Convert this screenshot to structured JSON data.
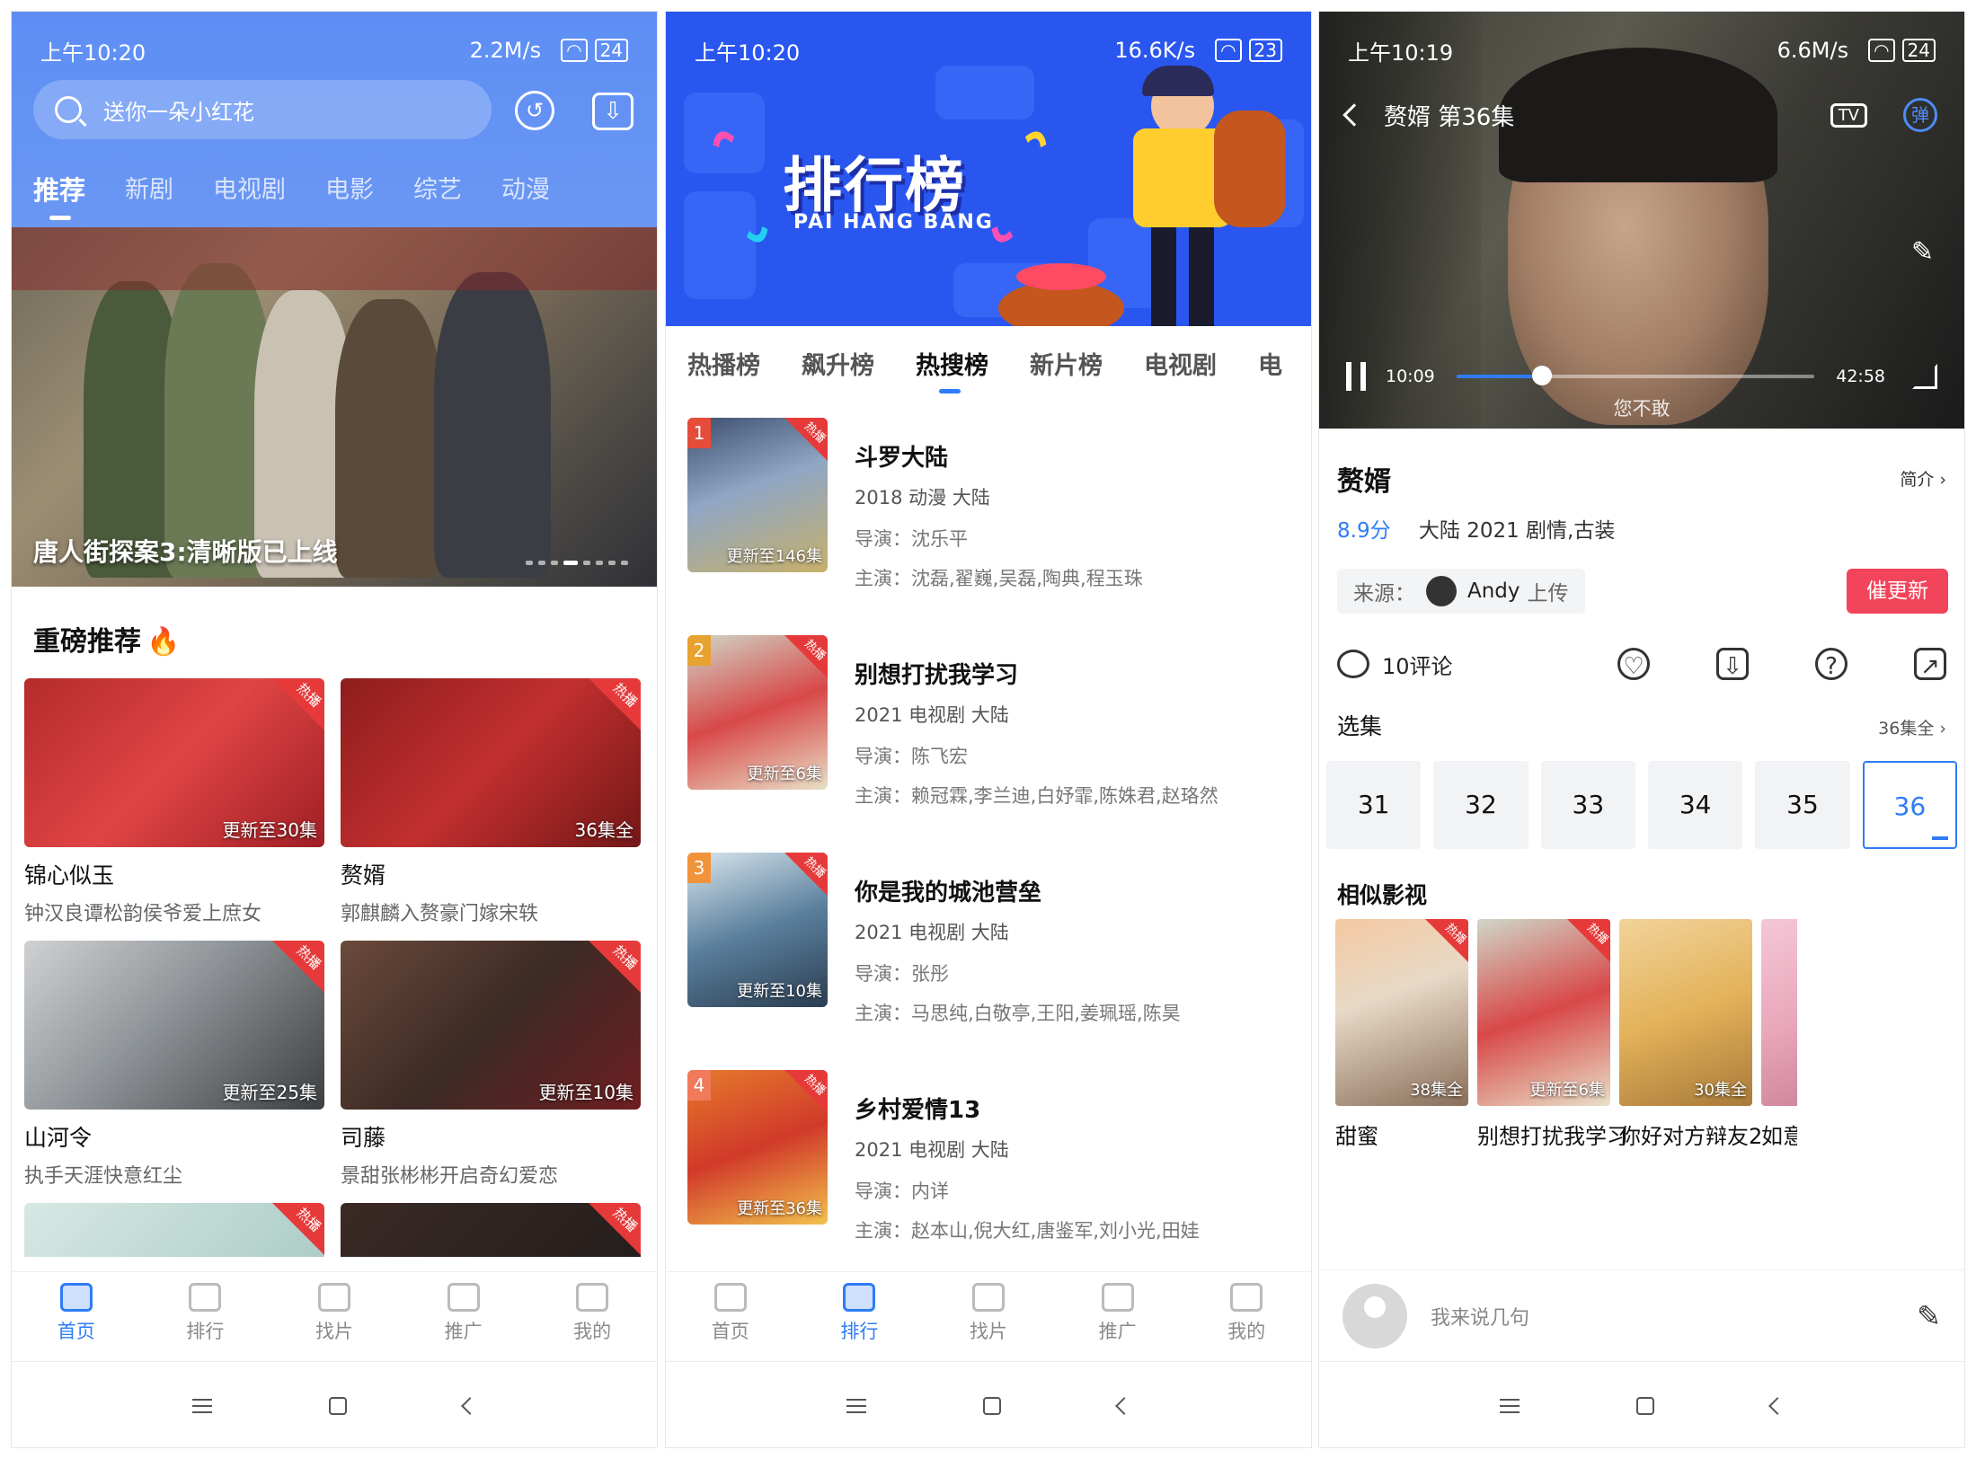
{
  "phone1": {
    "status": {
      "time": "上午10:20",
      "net": "2.2M/s",
      "battery": "24"
    },
    "search_placeholder": "送你一朵小红花",
    "tabs": [
      "推荐",
      "新剧",
      "电视剧",
      "电影",
      "综艺",
      "动漫"
    ],
    "active_tab": "推荐",
    "banner_caption": "唐人街探案3:清晰版已上线",
    "section_title": "重磅推荐",
    "cards": [
      {
        "name": "锦心似玉",
        "desc": "钟汉良谭松韵侯爷爱上庶女",
        "badge": "更新至30集",
        "hot": "热播"
      },
      {
        "name": "赘婿",
        "desc": "郭麒麟入赘豪门嫁宋轶",
        "badge": "36集全",
        "hot": "热播"
      },
      {
        "name": "山河令",
        "desc": "执手天涯快意红尘",
        "badge": "更新至25集",
        "hot": "热播"
      },
      {
        "name": "司藤",
        "desc": "景甜张彬彬开启奇幻爱恋",
        "badge": "更新至10集",
        "hot": "热播"
      }
    ],
    "partial_cards_hot": "热播",
    "nav": [
      "首页",
      "排行",
      "找片",
      "推广",
      "我的"
    ]
  },
  "phone2": {
    "status": {
      "time": "上午10:20",
      "net": "16.6K/s",
      "battery": "23"
    },
    "banner_title": "排行榜",
    "banner_sub": "PAI HANG BANG",
    "tabs": [
      "热播榜",
      "飙升榜",
      "热搜榜",
      "新片榜",
      "电视剧",
      "电"
    ],
    "active_tab": "热搜榜",
    "list": [
      {
        "rank": "1",
        "title": "斗罗大陆",
        "meta": "2018  动漫  大陆",
        "director": "导演：沈乐平",
        "actors": "主演：沈磊,翟巍,吴磊,陶典,程玉珠",
        "update": "更新至146集",
        "hot": "热播"
      },
      {
        "rank": "2",
        "title": "别想打扰我学习",
        "meta": "2021  电视剧  大陆",
        "director": "导演：陈飞宏",
        "actors": "主演：赖冠霖,李兰迪,白妤霏,陈姝君,赵珞然",
        "update": "更新至6集",
        "hot": "热播"
      },
      {
        "rank": "3",
        "title": "你是我的城池营垒",
        "meta": "2021  电视剧  大陆",
        "director": "导演：张彤",
        "actors": "主演：马思纯,白敬亭,王阳,姜珮瑶,陈昊",
        "update": "更新至10集",
        "hot": "热播"
      },
      {
        "rank": "4",
        "title": "乡村爱情13",
        "meta": "2021  电视剧  大陆",
        "director": "导演：内详",
        "actors": "主演：赵本山,倪大红,唐鉴军,刘小光,田娃",
        "update": "更新至36集",
        "hot": "热播"
      }
    ],
    "nav": [
      "首页",
      "排行",
      "找片",
      "推广",
      "我的"
    ]
  },
  "phone3": {
    "status": {
      "time": "上午10:19",
      "net": "6.6M/s",
      "battery": "24"
    },
    "player_title": "赘婿 第36集",
    "tv_label": "TV",
    "danmaku_label": "弹",
    "current_time": "10:09",
    "total_time": "42:58",
    "progress": 0.24,
    "subtitle": "您不敢",
    "title": "赘婿",
    "intro_label": "简介",
    "score": "8.9分",
    "meta": "大陆  2021  剧情,古装",
    "source_label": "来源：",
    "uploader": "Andy",
    "upload_suffix": "上传",
    "urge_label": "催更新",
    "comment_count": "10评论",
    "episodes_label": "选集",
    "episodes_all": "36集全",
    "episodes": [
      "31",
      "32",
      "33",
      "34",
      "35",
      "36"
    ],
    "active_episode": "36",
    "similar_title": "相似影视",
    "similar": [
      {
        "name": "甜蜜",
        "badge": "38集全",
        "hot": "热播"
      },
      {
        "name": "别想打扰我学习",
        "badge": "更新至6集",
        "hot": "热播"
      },
      {
        "name": "你好对方辩友2",
        "badge": "30集全",
        "hot": ""
      },
      {
        "name": "如意",
        "badge": "",
        "hot": ""
      }
    ],
    "comment_placeholder": "我来说几句"
  },
  "colors": {
    "accent": "#2f7cf6",
    "header_blue": "#5d8ef5",
    "hot_red": "#e63a3a",
    "urge_red": "#f2445a",
    "rank_banner": "#2a56f0"
  }
}
